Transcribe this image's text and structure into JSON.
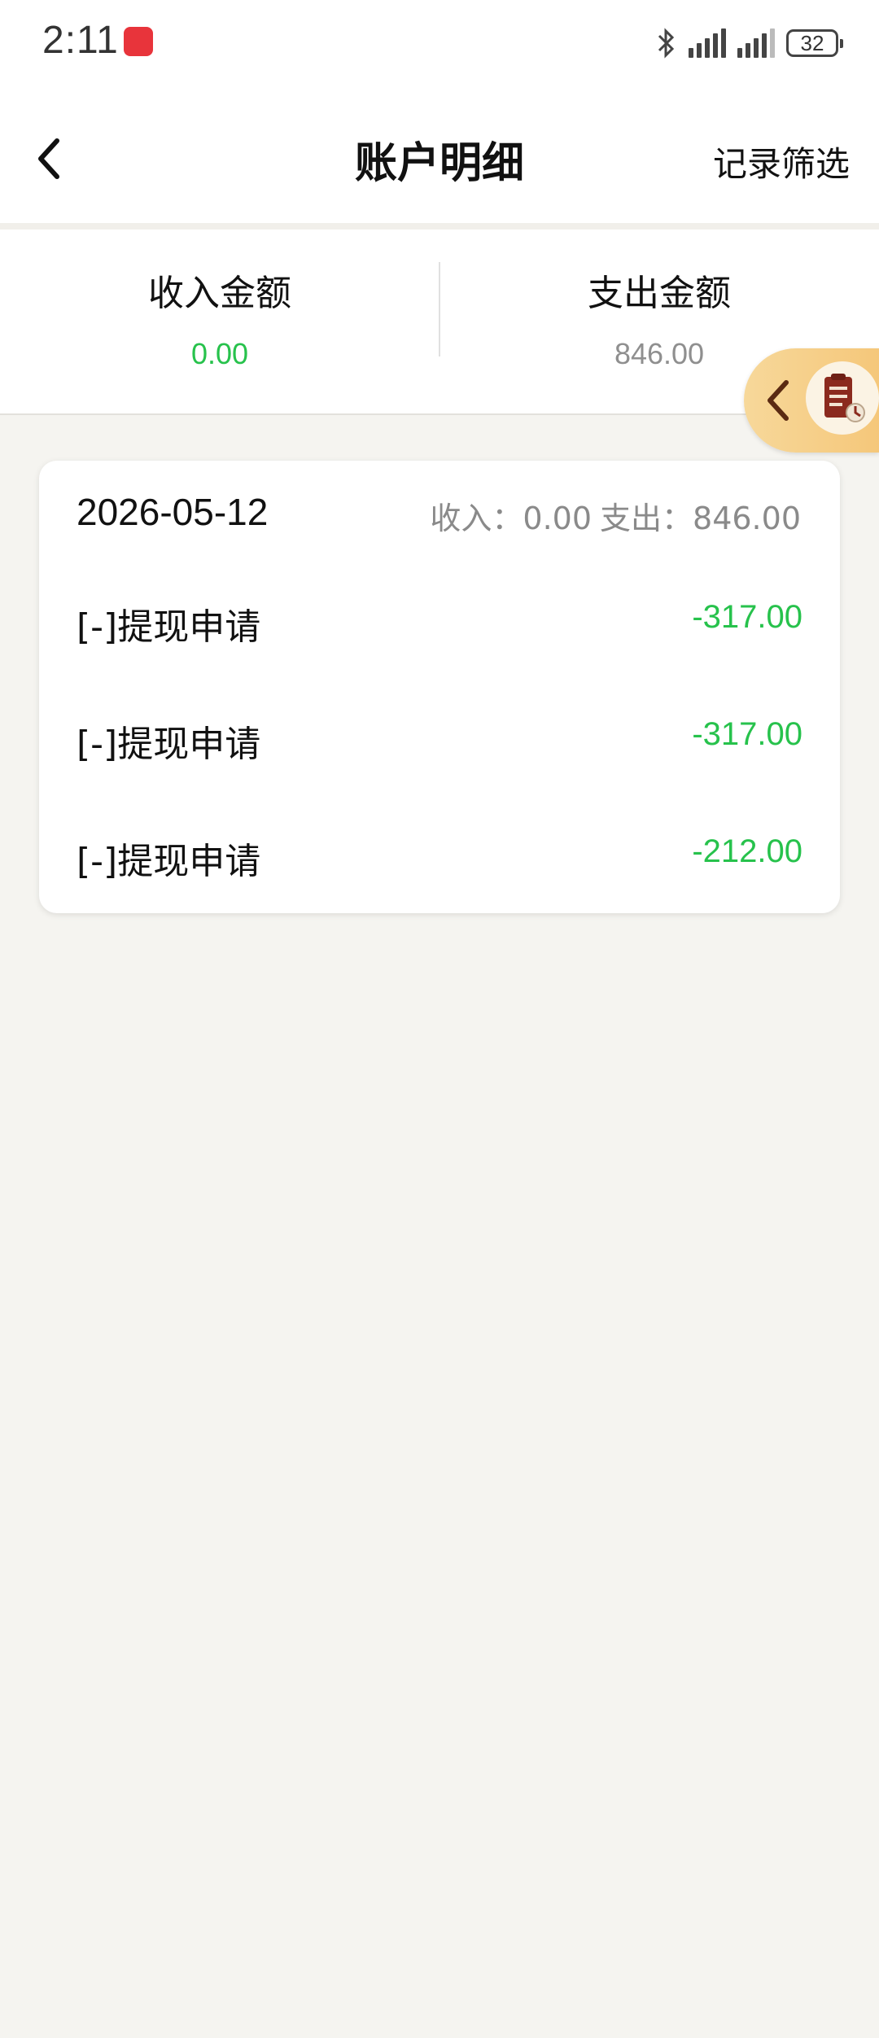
{
  "status_bar": {
    "time": "2:11",
    "battery": "32"
  },
  "nav": {
    "title": "账户明细",
    "filter_label": "记录筛选"
  },
  "summary": {
    "income_label": "收入金额",
    "income_value": "0.00",
    "expense_label": "支出金额",
    "expense_value": "846.00"
  },
  "records": {
    "date": "2026-05-12",
    "income_text": "收入：0.00",
    "expense_text": "支出：846.00",
    "items": [
      {
        "label": "[-]提现申请",
        "amount": "-317.00"
      },
      {
        "label": "[-]提现申请",
        "amount": "-317.00"
      },
      {
        "label": "[-]提现申请",
        "amount": "-212.00"
      }
    ]
  },
  "colors": {
    "income_green": "#27c24c",
    "muted_gray": "#8a8a8a",
    "float_tab": "#f5c77a"
  }
}
